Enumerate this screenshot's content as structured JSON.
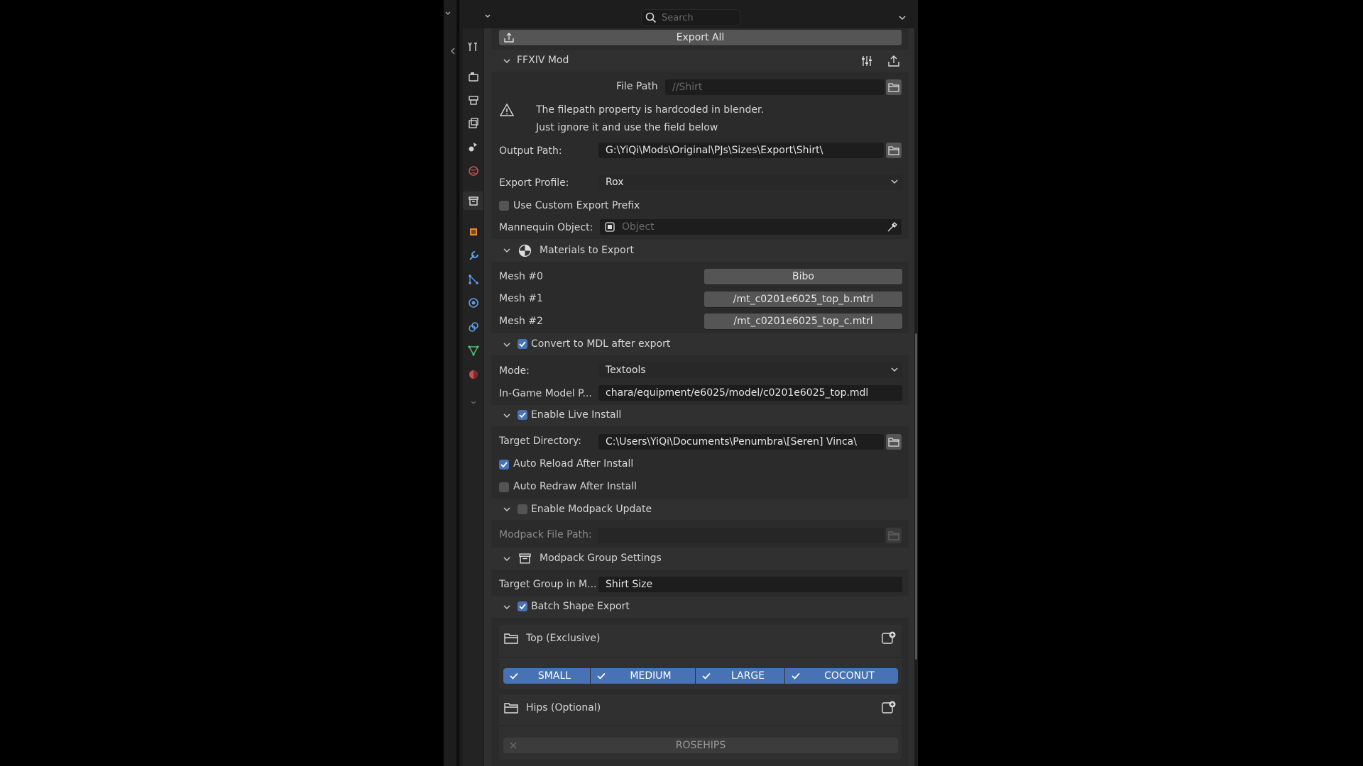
{
  "header": {
    "search_placeholder": "Search"
  },
  "export_all": {
    "label": "Export All"
  },
  "ffxiv": {
    "title": "FFXIV Mod",
    "file_path_label": "File Path",
    "file_path_value": "//Shirt",
    "warning_line1": "The filepath property is hardcoded in blender.",
    "warning_line2": "Just ignore it and use the field below",
    "output_path_label": "Output Path:",
    "output_path_value": "G:\\YiQi\\Mods\\Original\\PJs\\Sizes\\Export\\Shirt\\",
    "export_profile_label": "Export Profile:",
    "export_profile_value": "Rox",
    "custom_prefix_label": "Use Custom Export Prefix",
    "mannequin_label": "Mannequin Object:",
    "mannequin_placeholder": "Object"
  },
  "materials": {
    "title": "Materials to Export",
    "meshes": [
      {
        "label": "Mesh #0",
        "value": "Bibo"
      },
      {
        "label": "Mesh #1",
        "value": "/mt_c0201e6025_top_b.mtrl"
      },
      {
        "label": "Mesh #2",
        "value": "/mt_c0201e6025_top_c.mtrl"
      }
    ]
  },
  "convert": {
    "title": "Convert to MDL after export",
    "checked": true,
    "mode_label": "Mode:",
    "mode_value": "Textools",
    "ingame_label": "In-Game Model P...",
    "ingame_value": "chara/equipment/e6025/model/c0201e6025_top.mdl"
  },
  "live_install": {
    "title": "Enable Live Install",
    "checked": true,
    "target_dir_label": "Target Directory:",
    "target_dir_value": "C:\\Users\\YiQi\\Documents\\Penumbra\\[Seren] Vinca\\",
    "auto_reload_label": "Auto Reload After Install",
    "auto_reload_checked": true,
    "auto_redraw_label": "Auto Redraw After Install",
    "auto_redraw_checked": false
  },
  "modpack_update": {
    "title": "Enable Modpack Update",
    "checked": false,
    "file_path_label": "Modpack File Path:"
  },
  "group_settings": {
    "title": "Modpack Group Settings",
    "target_group_label": "Target Group in M...",
    "target_group_value": "Shirt Size"
  },
  "batch": {
    "title": "Batch Shape Export",
    "checked": true,
    "groups": [
      {
        "name": "Top (Exclusive)",
        "options": [
          "SMALL",
          "MEDIUM",
          "LARGE",
          "COCONUT"
        ]
      },
      {
        "name": "Hips (Optional)",
        "options": [
          "ROSEHIPS"
        ]
      }
    ]
  },
  "colors": {
    "accent": "#4772b3",
    "panel_bg": "#2b2b2b",
    "button_bg": "#555555",
    "field_bg": "#1d1d1d"
  }
}
